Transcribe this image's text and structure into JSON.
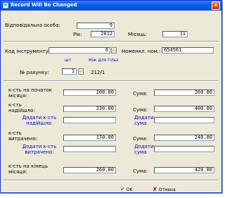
{
  "window": {
    "title": "Record Will Be Changed"
  },
  "form": {
    "responsible": {
      "label": "Відповідальна особа:",
      "value": "9"
    },
    "year": {
      "label": "Рік:",
      "value": "2012"
    },
    "month": {
      "label": "Місяць:",
      "value": "11"
    },
    "instrument_code": {
      "label": "Код інструменту:",
      "value": "6",
      "note_sht": "шт",
      "note_blade": "Ніж для гільз"
    },
    "nomenclature": {
      "label": "Номенкл. ном.:",
      "value": "654561"
    },
    "account": {
      "label": "№ рахунку:",
      "value": "1",
      "suffix": "212/1"
    },
    "start_qty": {
      "label_line1": "к-сть на початок",
      "label_line2": "місяця:",
      "value": "200.00"
    },
    "start_sum": {
      "label": "Сума:",
      "value": "260.00"
    },
    "received_qty": {
      "label_line1": "к-сть",
      "label_line2": "надійшло:",
      "value": "230.00"
    },
    "received_sum": {
      "label": "Сума:",
      "value": "400.00"
    },
    "add_received_qty": {
      "label_line1": "Додати к-сть",
      "label_line2": "надійшло:",
      "value": ""
    },
    "add_received_sum": {
      "label_line1": "Додати",
      "label_line2": "сума",
      "value": ""
    },
    "spent_qty": {
      "label_line1": "к-сть",
      "label_line2": "витрачено:",
      "value": "170.00"
    },
    "spent_sum": {
      "label": "Сума:",
      "value": "240.00"
    },
    "add_spent_qty": {
      "label_line1": "Додати к-сть",
      "label_line2": "витрачено:",
      "value": ""
    },
    "add_spent_sum": {
      "label_line1": "Додати",
      "label_line2": "сума",
      "value": ""
    },
    "end_qty": {
      "label_line1": "к-сть на кінець",
      "label_line2": "місяця:",
      "value": "260.00"
    },
    "end_sum": {
      "label": "Сума:",
      "value": "420.00"
    }
  },
  "buttons": {
    "ok": "OK",
    "cancel": "Отмена"
  },
  "colors": {
    "title_bar": "#0a5ee8",
    "link_blue": "#0000c0",
    "window_bg": "#ece9d8"
  }
}
